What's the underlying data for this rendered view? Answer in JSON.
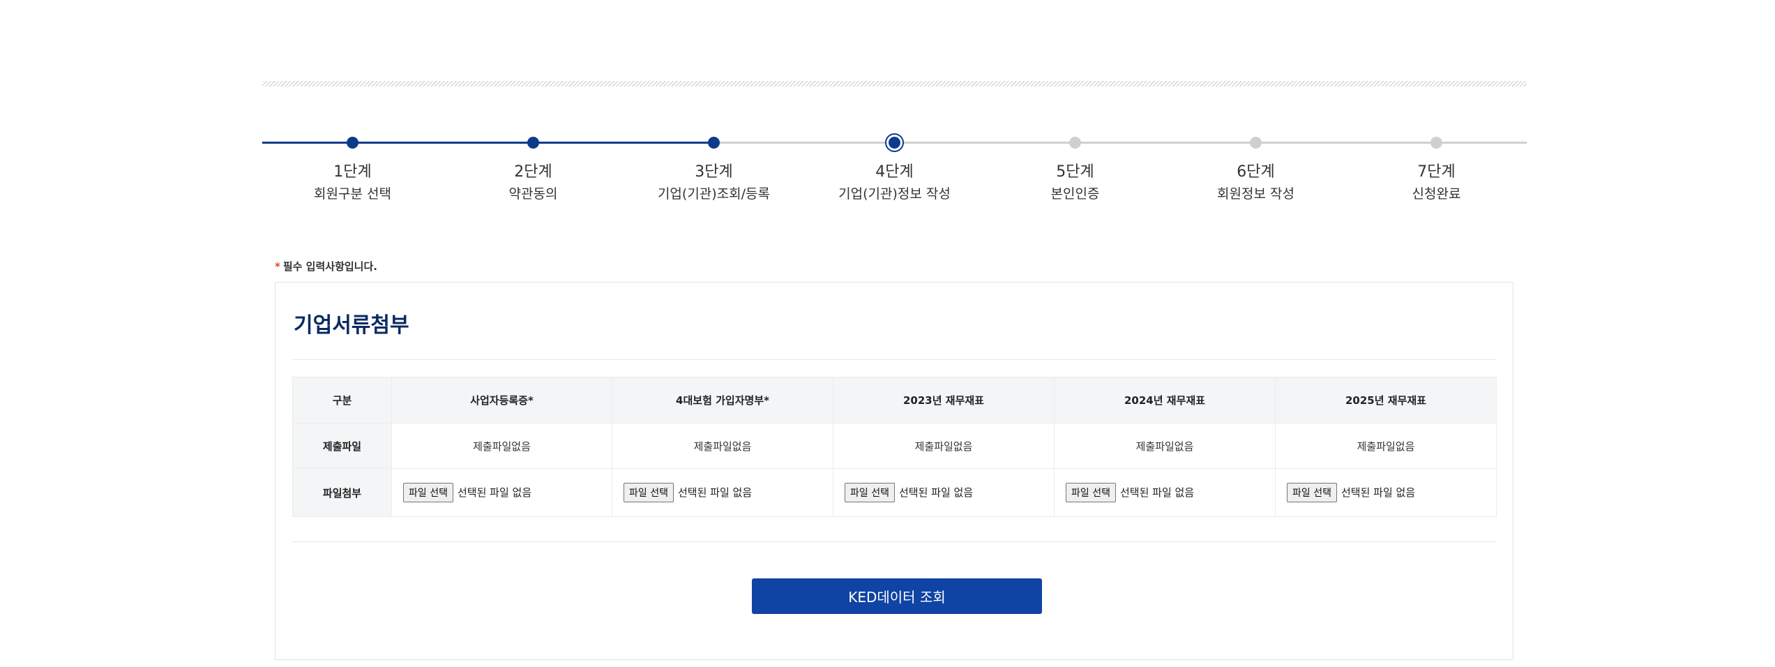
{
  "steps": [
    {
      "num": "1단계",
      "name": "회원구분 선택",
      "state": "done"
    },
    {
      "num": "2단계",
      "name": "약관동의",
      "state": "done"
    },
    {
      "num": "3단계",
      "name": "기업(기관)조회/등록",
      "state": "done"
    },
    {
      "num": "4단계",
      "name": "기업(기관)정보 작성",
      "state": "current"
    },
    {
      "num": "5단계",
      "name": "본인인증",
      "state": "pending"
    },
    {
      "num": "6단계",
      "name": "회원정보 작성",
      "state": "pending"
    },
    {
      "num": "7단계",
      "name": "신청완료",
      "state": "pending"
    }
  ],
  "required_note": {
    "star": "*",
    "text": "필수 입력사항입니다."
  },
  "card": {
    "title": "기업서류첨부",
    "table": {
      "corner": "구분",
      "columns": [
        "사업자등록증*",
        "4대보험 가입자명부*",
        "2023년 재무재표",
        "2024년 재무재표",
        "2025년 재무재표"
      ],
      "row_submitted": {
        "label": "제출파일",
        "values": [
          "제출파일없음",
          "제출파일없음",
          "제출파일없음",
          "제출파일없음",
          "제출파일없음"
        ]
      },
      "row_attach": {
        "label": "파일첨부",
        "button_label": "파일 선택",
        "status": "선택된 파일 없음"
      }
    },
    "ked_button": "KED데이터 조회"
  },
  "colors": {
    "primary": "#0f44a4",
    "step_active": "#0c3b8a",
    "step_pending": "#cfcfcf",
    "title": "#0b2a63",
    "required_star": "#e8491d"
  }
}
